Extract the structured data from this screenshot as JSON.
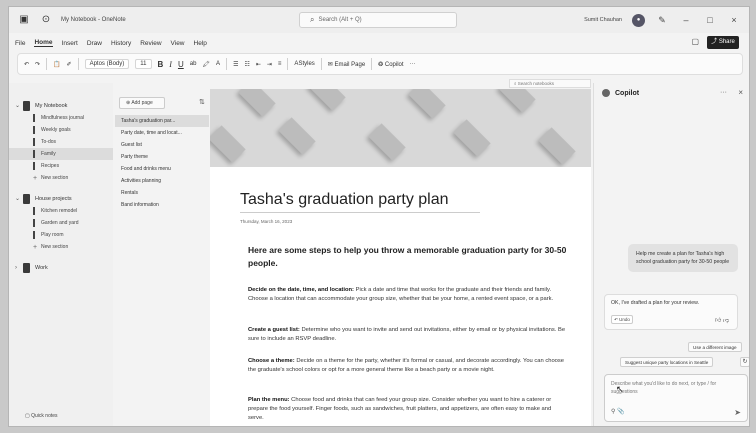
{
  "titlebar": {
    "app_title": "My Notebook - OneNote",
    "search_placeholder": "Search (Alt + Q)",
    "user_name": "Sumit Chauhan",
    "minimize": "–",
    "maximize": "□",
    "close": "×"
  },
  "menu": {
    "items": [
      "File",
      "Home",
      "Insert",
      "Draw",
      "History",
      "Review",
      "View",
      "Help"
    ],
    "active": "Home",
    "share_label": "Share"
  },
  "toolbar": {
    "font_name": "Aptos (Body)",
    "font_size": "11",
    "bold": "B",
    "italic": "I",
    "underline": "U",
    "strike": "ab",
    "styles_label": "Styles",
    "email_page_label": "Email Page",
    "copilot_label": "Copilot",
    "more": "···"
  },
  "notebooks": {
    "items": [
      {
        "name": "My Notebook",
        "expanded": true,
        "sections": [
          "Mindfulness journal",
          "Weekly goals",
          "To-dos",
          "Family",
          "Recipes"
        ],
        "new_section": "New section",
        "active_section": "Family"
      },
      {
        "name": "House projects",
        "expanded": true,
        "sections": [
          "Kitchen remodel",
          "Garden and yard",
          "Play room"
        ],
        "new_section": "New section"
      },
      {
        "name": "Work",
        "expanded": false,
        "sections": []
      }
    ],
    "quick_notes": "Quick notes"
  },
  "pages": {
    "add_page_label": "Add page",
    "items": [
      "Tasha's graduation par...",
      "Party date, time and locat...",
      "Guest list",
      "Party theme",
      "Food and drinks menu",
      "Activities planning",
      "Rentals",
      "Band information"
    ],
    "active_index": 0
  },
  "canvas": {
    "search_notebooks_placeholder": "Search notebooks",
    "title": "Tasha's graduation party plan",
    "date": "Thursday, March 16, 2023",
    "intro": "Here are some steps to help you throw a memorable graduation party for 30-50 people.",
    "steps": [
      {
        "lead": "Decide on the date, time, and location:",
        "text": " Pick a date and time that works for the graduate and their friends and family. Choose a location that can accommodate your group size, whether that be your home, a rented event space, or a park."
      },
      {
        "lead": "Create a guest list:",
        "text": " Determine who you want to invite and send out invitations, either by email or by physical invitations. Be sure to include an RSVP deadline."
      },
      {
        "lead": "Choose a theme:",
        "text": " Decide on a theme for the party, whether it's formal or casual, and decorate accordingly. You can choose the graduate's school colors or opt for a more general theme like a beach party or a movie night."
      },
      {
        "lead": "Plan the menu:",
        "text": " Choose food and drinks that can feed your group size. Consider whether you want to hire a caterer or prepare the food yourself. Finger foods, such as sandwiches, fruit platters, and appetizers, are often easy to make and serve."
      }
    ]
  },
  "copilot": {
    "title": "Copilot",
    "more": "···",
    "close": "×",
    "user_message": "Help me create a plan for Tasha's high school graduation party for 30-50 people",
    "bot_message": "OK, I've drafted a plan for your review.",
    "undo_label": "Undo",
    "chip1": "Use a different image",
    "chip2": "Suggest unique party locations in Seattle",
    "input_placeholder": "Describe what you'd like to do next, or type / for suggestions"
  },
  "colors": {
    "background": "#f3f3f3",
    "canvas": "#ffffff",
    "accent": "#222222"
  }
}
